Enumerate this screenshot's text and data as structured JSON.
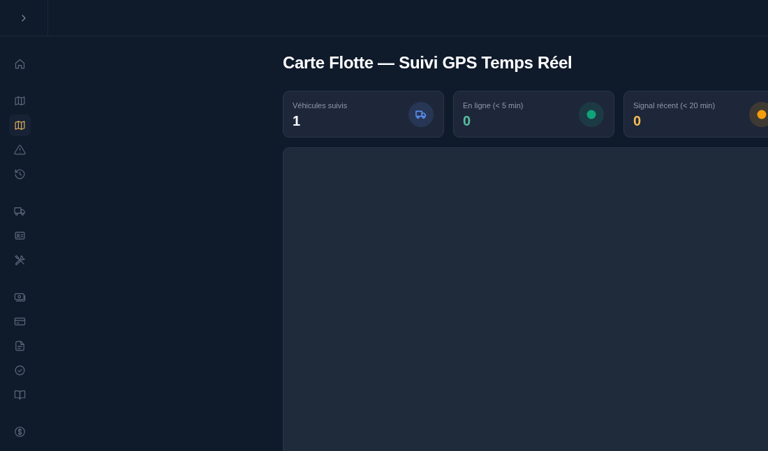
{
  "sidebar": {
    "sections": [
      {
        "items": [
          {
            "selected": false
          }
        ]
      },
      {
        "items": [
          {
            "selected": false
          },
          {
            "selected": true
          },
          {
            "selected": false
          },
          {
            "selected": false
          }
        ]
      },
      {
        "items": [
          {
            "selected": false
          },
          {
            "selected": false
          },
          {
            "selected": false
          }
        ]
      },
      {
        "items": [
          {
            "selected": false
          },
          {
            "selected": false
          },
          {
            "selected": false
          },
          {
            "selected": false
          },
          {
            "selected": false
          }
        ]
      },
      {
        "items": [
          {
            "selected": false
          }
        ]
      }
    ]
  },
  "page": {
    "title": "Carte Flotte — Suivi GPS Temps Réel"
  },
  "stats": [
    {
      "kind": "total",
      "label": "Véhicules suivis",
      "value": "1",
      "color": "#5b8def"
    },
    {
      "kind": "online",
      "label": "En ligne (< 5 min)",
      "value": "0",
      "color": "#10a37a"
    },
    {
      "kind": "recent",
      "label": "Signal récent (< 20 min)",
      "value": "0",
      "color": "#f59e0b"
    }
  ]
}
